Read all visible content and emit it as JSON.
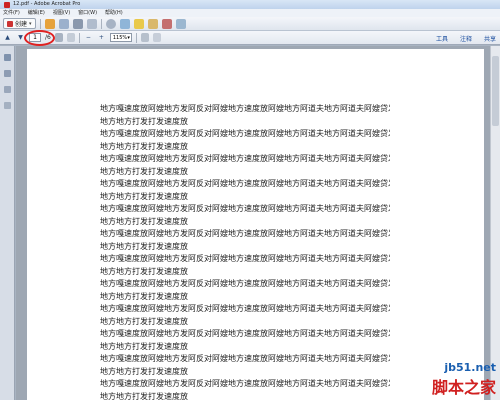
{
  "window": {
    "title": "12.pdf - Adobe Acrobat Pro"
  },
  "menubar": {
    "items": [
      "文件(F)",
      "编辑(E)",
      "视图(V)",
      "窗口(W)",
      "帮助(H)"
    ]
  },
  "toolbar": {
    "create_label": "创建",
    "create_caret": "▾"
  },
  "nav": {
    "page_current": "1",
    "page_total": "/6",
    "zoom": "115%",
    "zoom_caret": "▾"
  },
  "tabs": {
    "tools": "工具",
    "comment": "注释",
    "share": "共享"
  },
  "document": {
    "lines": [
      "地方嘎速度放阿嫂地方发阿反对阿嫂地方速度放阿嫂地方阿道夫地方阿道夫阿嫂贷发阿嫂",
      "地方地方打发打发速度放",
      "地方嘎速度放阿嫂地方发阿反对阿嫂地方速度放阿嫂地方阿道夫地方阿道夫阿嫂贷发阿嫂",
      "地方地方打发打发速度放",
      "地方嘎速度放阿嫂地方发阿反对阿嫂地方速度放阿嫂地方阿道夫地方阿道夫阿嫂贷发阿嫂",
      "地方地方打发打发速度放",
      "地方嘎速度放阿嫂地方发阿反对阿嫂地方速度放阿嫂地方阿道夫地方阿道夫阿嫂贷发阿嫂",
      "地方地方打发打发速度放",
      "地方嘎速度放阿嫂地方发阿反对阿嫂地方速度放阿嫂地方阿道夫地方阿道夫阿嫂贷发阿嫂",
      "地方地方打发打发速度放",
      "地方嘎速度放阿嫂地方发阿反对阿嫂地方速度放阿嫂地方阿道夫地方阿道夫阿嫂贷发阿嫂",
      "地方地方打发打发速度放",
      "地方嘎速度放阿嫂地方发阿反对阿嫂地方速度放阿嫂地方阿道夫地方阿道夫阿嫂贷发阿嫂",
      "地方地方打发打发速度放",
      "地方嘎速度放阿嫂地方发阿反对阿嫂地方速度放阿嫂地方阿道夫地方阿道夫阿嫂贷发阿嫂",
      "地方地方打发打发速度放",
      "地方嘎速度放阿嫂地方发阿反对阿嫂地方速度放阿嫂地方阿道夫地方阿道夫阿嫂贷发阿嫂",
      "地方地方打发打发速度放",
      "地方嘎速度放阿嫂地方发阿反对阿嫂地方速度放阿嫂地方阿道夫地方阿道夫阿嫂贷发阿嫂",
      "地方地方打发打发速度放",
      "地方嘎速度放阿嫂地方发阿反对阿嫂地方速度放阿嫂地方阿道夫地方阿道夫阿嫂贷发阿嫂",
      "地方地方打发打发速度放",
      "地方嘎速度放阿嫂地方发阿反对阿嫂地方速度放阿嫂地方阿道夫地方阿道夫阿嫂贷发阿嫂",
      "地方地方打发打发速度放"
    ]
  },
  "watermark": {
    "site": "jb51.net",
    "name": "脚本之家"
  },
  "colors": {
    "highlight": "#e02020",
    "link_blue": "#1d4fa0"
  }
}
